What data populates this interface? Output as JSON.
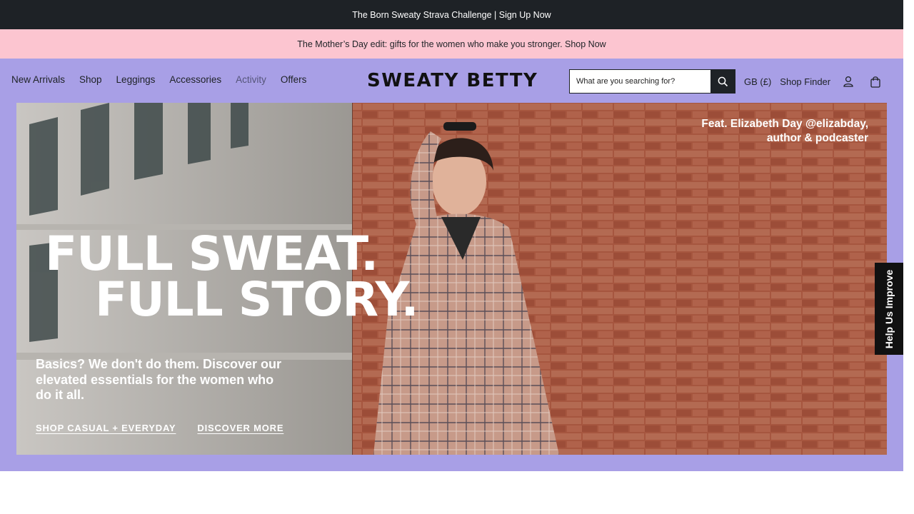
{
  "announcement": {
    "text": "The Born Sweaty Strava Challenge | Sign Up Now"
  },
  "promo": {
    "text": "The Mother’s Day edit: gifts for the women who make you stronger. Shop Now"
  },
  "header": {
    "nav": [
      {
        "label": "New Arrivals"
      },
      {
        "label": "Shop"
      },
      {
        "label": "Leggings"
      },
      {
        "label": "Accessories"
      },
      {
        "label": "Activity"
      },
      {
        "label": "Offers"
      }
    ],
    "logo": "SWEATY BETTY",
    "search": {
      "placeholder": "What are you searching for?",
      "icon": "search-icon"
    },
    "region": "GB (£)",
    "shop_finder": "Shop Finder",
    "account_icon": "user-icon",
    "bag_icon": "bag-icon"
  },
  "hero": {
    "credit_line1": "Feat. Elizabeth Day @elizabday,",
    "credit_line2": "author & podcaster",
    "headline_line1": "FULL SWEAT.",
    "headline_line2": "FULL STORY.",
    "subtext": "Basics? We don't do them. Discover our elevated essentials for the women who do it all.",
    "cta_primary": "SHOP CASUAL + EVERYDAY",
    "cta_secondary": "DISCOVER MORE"
  },
  "feedback_tab": {
    "label": "Help Us Improve"
  },
  "colors": {
    "dark": "#1e2226",
    "promo_pink": "#fcc5d0",
    "header_lilac": "#a89fe6",
    "brick": "#a45a45"
  }
}
